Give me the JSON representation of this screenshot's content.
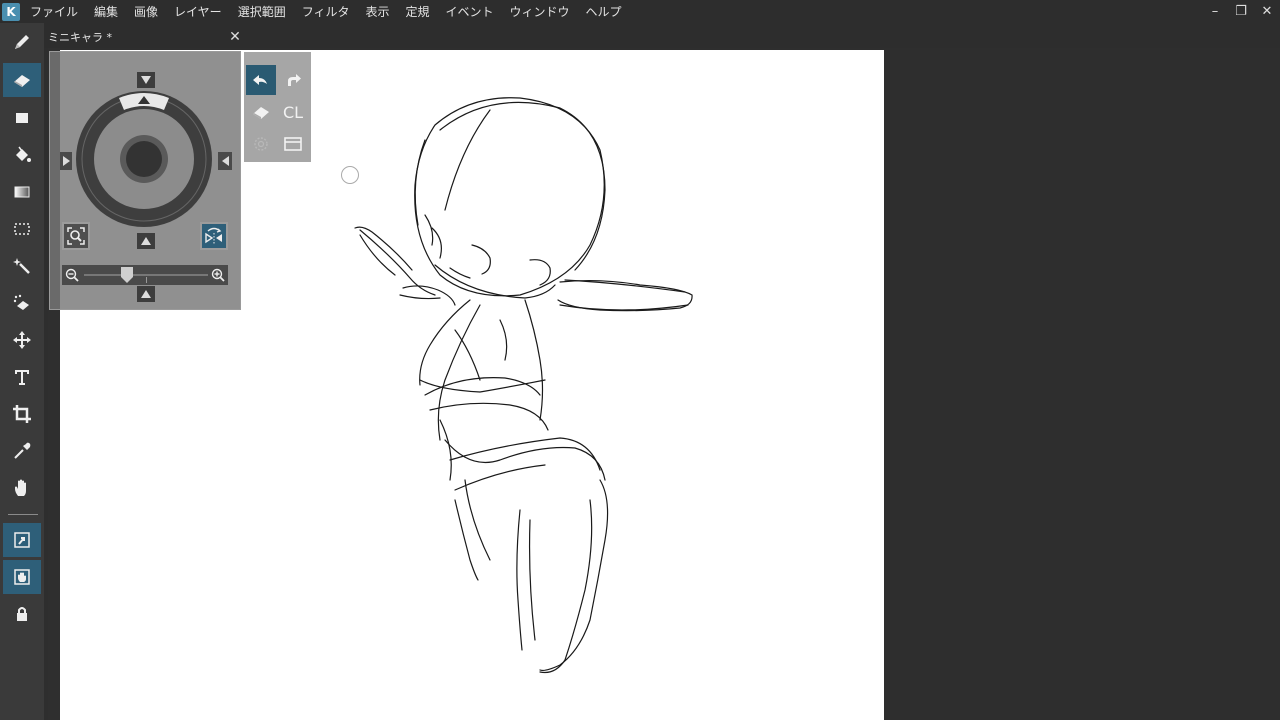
{
  "menubar": {
    "items": [
      "ファイル",
      "編集",
      "画像",
      "レイヤー",
      "選択範囲",
      "フィルタ",
      "表示",
      "定規",
      "イベント",
      "ウィンドウ",
      "ヘルプ"
    ],
    "logo_letter": "K",
    "minimize": "–",
    "restore": "❐",
    "close": "✕"
  },
  "tab": {
    "title": "ミニキャラ *",
    "close": "✕"
  },
  "toolbar": {
    "tools": [
      {
        "name": "pen-tool",
        "icon": "pen-icon",
        "active": false
      },
      {
        "name": "eraser-tool",
        "icon": "eraser-icon",
        "active": true
      },
      {
        "name": "rectangle-tool",
        "icon": "rectangle-icon",
        "active": false
      },
      {
        "name": "fill-tool",
        "icon": "paint-bucket-icon",
        "active": false
      },
      {
        "name": "gradient-tool",
        "icon": "gradient-icon",
        "active": false
      },
      {
        "name": "selection-tool",
        "icon": "marquee-icon",
        "active": false
      },
      {
        "name": "magic-wand-tool",
        "icon": "magic-wand-icon",
        "active": false
      },
      {
        "name": "select-eraser-tool",
        "icon": "select-eraser-icon",
        "active": false
      },
      {
        "name": "move-tool",
        "icon": "move-icon",
        "active": false
      },
      {
        "name": "text-tool",
        "icon": "text-icon",
        "active": false
      },
      {
        "name": "crop-tool",
        "icon": "crop-icon",
        "active": false
      },
      {
        "name": "eyedropper-tool",
        "icon": "eyedropper-icon",
        "active": false
      },
      {
        "name": "hand-tool",
        "icon": "hand-icon",
        "active": false
      },
      {
        "name": "layer-move-toggle",
        "icon": "layer-move-icon",
        "active": true
      },
      {
        "name": "layer-hand-toggle",
        "icon": "layer-hand-icon",
        "active": true
      },
      {
        "name": "lock-tool",
        "icon": "lock-icon",
        "active": false
      }
    ]
  },
  "quick_panel": {
    "clear_label": "CL"
  },
  "navigator": {
    "zoom_level": 0.35
  },
  "colors": {
    "accent": "#2e5f79",
    "background": "#2d2d2d",
    "toolbar": "#3a3a3a",
    "canvas": "#ffffff"
  }
}
